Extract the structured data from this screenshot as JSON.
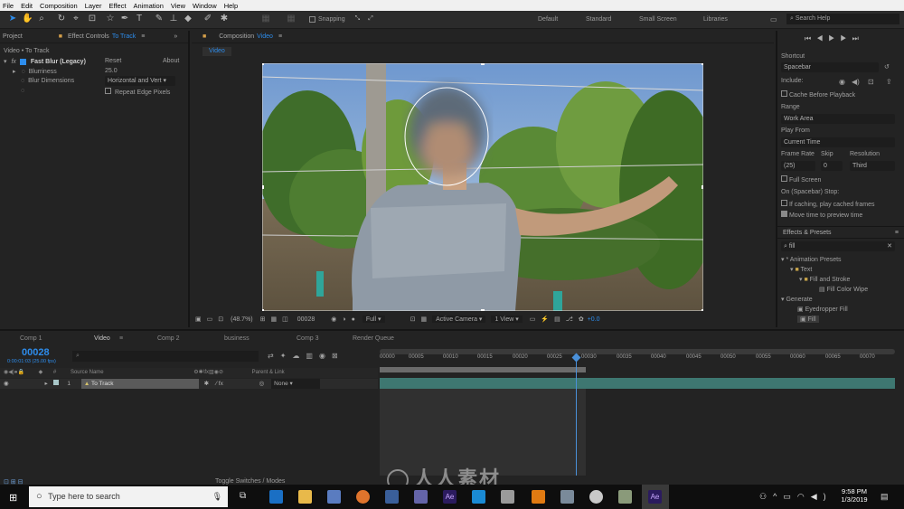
{
  "menu": [
    "File",
    "Edit",
    "Composition",
    "Layer",
    "Effect",
    "Animation",
    "View",
    "Window",
    "Help"
  ],
  "toolbar": {
    "snapping_label": "Snapping",
    "workspaces": [
      "Default",
      "Standard",
      "Small Screen",
      "Libraries"
    ],
    "search_help": "Search Help"
  },
  "left_panel": {
    "project_tab": "Project",
    "effect_controls_prefix": "Effect Controls",
    "effect_controls_layer": "To Track",
    "layer_path": "Video • To Track",
    "effect_name": "Fast Blur (Legacy)",
    "reset": "Reset",
    "about": "About",
    "blurriness_label": "Blurriness",
    "blurriness_value": "25.0",
    "blur_dimensions_label": "Blur Dimensions",
    "blur_dimensions_value": "Horizontal and Vert",
    "repeat_edge_label": "Repeat Edge Pixels"
  },
  "composition": {
    "tab_prefix": "Composition",
    "tab_name": "Video",
    "comp_tab": "Video",
    "zoom": "(48.7%)",
    "frame": "00028",
    "resolution": "Full",
    "camera": "Active Camera",
    "view": "1 View",
    "exposure": "+0.0"
  },
  "right_panel": {
    "shortcut_label": "Shortcut",
    "shortcut_value": "Spacebar",
    "include_label": "Include:",
    "cache_label": "Cache Before Playback",
    "range_label": "Range",
    "range_value": "Work Area",
    "play_from_label": "Play From",
    "play_from_value": "Current Time",
    "frame_rate_label": "Frame Rate",
    "skip_label": "Skip",
    "resolution_label": "Resolution",
    "frame_rate_value": "(25)",
    "skip_value": "0",
    "resolution_value": "Third",
    "full_screen_label": "Full Screen",
    "stop_label": "On (Spacebar) Stop:",
    "if_caching_label": "If caching, play cached frames",
    "move_time_label": "Move time to preview time",
    "effects_presets_label": "Effects & Presets",
    "search_value": "fill",
    "tree": [
      "* Animation Presets",
      "Text",
      "Fill and Stroke",
      "Fill Color Wipe",
      "Generate",
      "Eyedropper Fill",
      "Fill"
    ]
  },
  "timeline": {
    "tabs": [
      "Comp 1",
      "Video",
      "Comp 2",
      "business",
      "Comp 3",
      "Render Queue"
    ],
    "timecode": "00028",
    "timecode_sub": "0:00:01:03 (25.00 fps)",
    "col_source": "Source Name",
    "col_parent": "Parent & Link",
    "layer_index": "1",
    "layer_name": "To Track",
    "parent_value": "None",
    "ruler": [
      "00000",
      "00005",
      "00010",
      "00015",
      "00020",
      "00025",
      "00030",
      "00035",
      "00040",
      "00045",
      "00050",
      "00055",
      "00060",
      "00065",
      "00070"
    ],
    "toggle_label": "Toggle Switches / Modes"
  },
  "taskbar": {
    "search_placeholder": "Type here to search",
    "time": "9:58 PM",
    "date": "1/3/2019"
  },
  "watermark": "人人素材",
  "colors": {
    "accent": "#2d8ceb",
    "track_bar": "#6fa39a",
    "playhead": "#4a90d9",
    "layer_label": "#d6c36b"
  }
}
